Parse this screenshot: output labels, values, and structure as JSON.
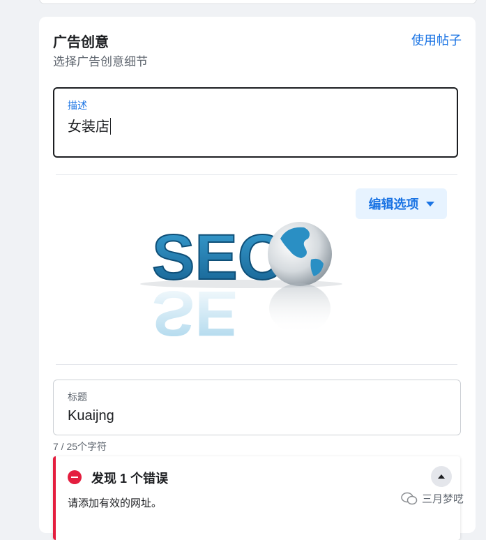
{
  "card": {
    "title": "广告创意",
    "subtitle": "选择广告创意细节",
    "use_post_link": "使用帖子"
  },
  "description_field": {
    "label": "描述",
    "value": "女装店"
  },
  "media": {
    "edit_button_label": "编辑选项",
    "image_text": "SEO"
  },
  "title_field": {
    "label": "标题",
    "value": "Kuaijng",
    "char_count": "7 / 25个字符"
  },
  "error": {
    "title": "发现 1 个错误",
    "message": "请添加有效的网址。"
  },
  "watermark": {
    "text": "三月梦呓"
  },
  "colors": {
    "accent": "#1b74e4",
    "error": "#e41e3f",
    "seo_letters": "#1f7fb3"
  }
}
